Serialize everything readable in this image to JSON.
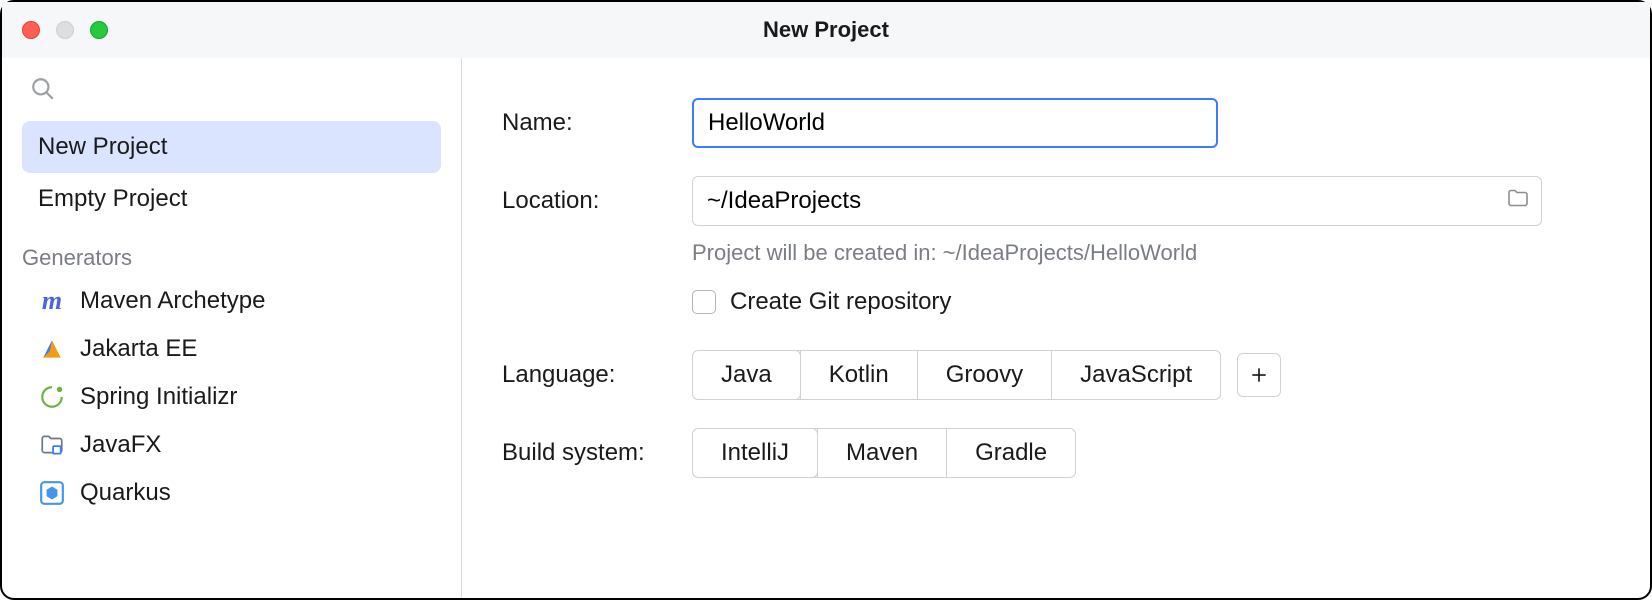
{
  "window": {
    "title": "New Project"
  },
  "sidebar": {
    "items": [
      {
        "label": "New Project",
        "selected": true
      },
      {
        "label": "Empty Project",
        "selected": false
      }
    ],
    "generators_header": "Generators",
    "generators": [
      {
        "label": "Maven Archetype",
        "icon": "maven-icon",
        "color": "#4a63e6"
      },
      {
        "label": "Jakarta EE",
        "icon": "jakarta-icon",
        "color": "#f39c12"
      },
      {
        "label": "Spring Initializr",
        "icon": "spring-icon",
        "color": "#6db33f"
      },
      {
        "label": "JavaFX",
        "icon": "javafx-icon",
        "color": "#6c7a89"
      },
      {
        "label": "Quarkus",
        "icon": "quarkus-icon",
        "color": "#4695eb"
      }
    ]
  },
  "form": {
    "name_label": "Name:",
    "name_value": "HelloWorld",
    "location_label": "Location:",
    "location_value": "~/IdeaProjects",
    "location_hint": "Project will be created in: ~/IdeaProjects/HelloWorld",
    "git_checkbox_label": "Create Git repository",
    "git_checked": false,
    "language_label": "Language:",
    "languages": [
      {
        "label": "Java",
        "selected": true
      },
      {
        "label": "Kotlin",
        "selected": false
      },
      {
        "label": "Groovy",
        "selected": false
      },
      {
        "label": "JavaScript",
        "selected": false
      }
    ],
    "build_label": "Build system:",
    "build_systems": [
      {
        "label": "IntelliJ",
        "selected": true
      },
      {
        "label": "Maven",
        "selected": false
      },
      {
        "label": "Gradle",
        "selected": false
      }
    ]
  }
}
